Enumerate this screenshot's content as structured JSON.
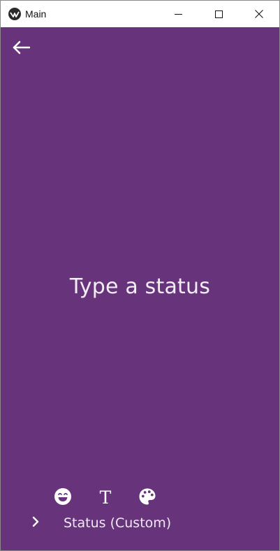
{
  "window": {
    "title": "Main",
    "controls": {
      "minimize": "minimize-icon",
      "maximize": "maximize-icon",
      "close": "close-icon"
    }
  },
  "colors": {
    "background": "#67337b",
    "foreground": "#ffffff",
    "titlebar": "#ffffff"
  },
  "header": {
    "back_icon": "arrow-left-icon"
  },
  "main": {
    "status_placeholder": "Type a status"
  },
  "toolbar": {
    "icons": [
      "emoji-icon",
      "text-format-icon",
      "palette-icon"
    ],
    "text_glyph": "T"
  },
  "footer": {
    "expand_icon": "chevron-right-icon",
    "status_type": "Status (Custom)"
  }
}
